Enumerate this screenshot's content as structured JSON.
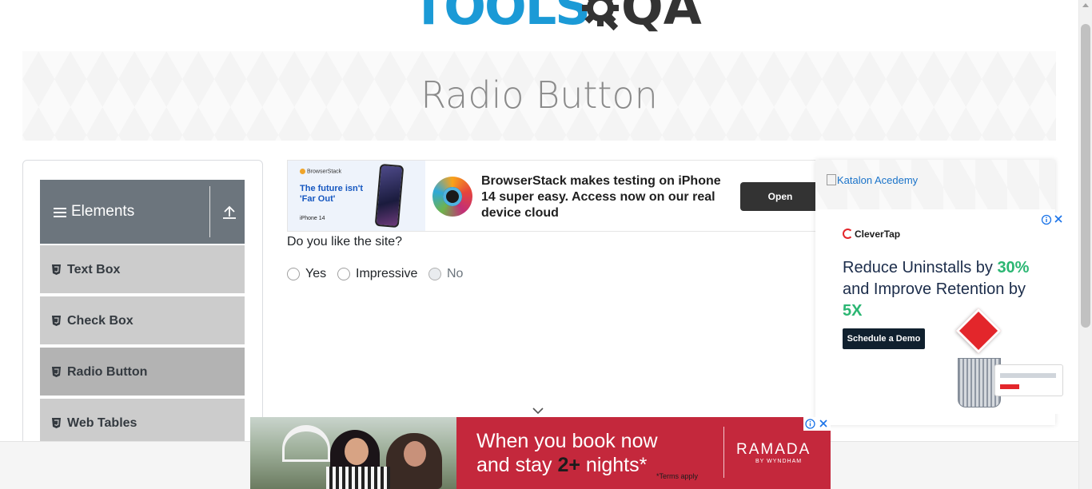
{
  "logo": {
    "text_primary": "TOOLS",
    "text_secondary": "QA"
  },
  "banner": {
    "title": "Radio Button"
  },
  "sidebar": {
    "group": {
      "title": "Elements"
    },
    "items": [
      {
        "label": "Text Box",
        "active": false
      },
      {
        "label": "Check Box",
        "active": false
      },
      {
        "label": "Radio Button",
        "active": true
      },
      {
        "label": "Web Tables",
        "active": false
      }
    ]
  },
  "top_ad": {
    "brand": "BrowserStack",
    "tagline": "The future isn't 'Far Out'",
    "device": "iPhone 14",
    "text": "BrowserStack makes testing on iPhone 14 super easy. Access now on our real device cloud",
    "button": "Open"
  },
  "form": {
    "question": "Do you like the site?",
    "options": [
      {
        "label": "Yes",
        "disabled": false
      },
      {
        "label": "Impressive",
        "disabled": false
      },
      {
        "label": "No",
        "disabled": true
      }
    ]
  },
  "right_card": {
    "image_alt": "Katalon Acedemy",
    "ad": {
      "brand": "CleverTap",
      "headline_1": "Reduce Uninstalls by ",
      "highlight_1": "30%",
      "headline_2": " and Improve Retention by ",
      "highlight_2": "5X",
      "cta": "Schedule a Demo"
    }
  },
  "bottom_ad": {
    "line1": "When you book now",
    "line2_pre": "and stay ",
    "line2_bold": "2+",
    "line2_post": " nights*",
    "terms": "*Terms apply",
    "brand": "RAMADA",
    "brand_sub": "BY WYNDHAM"
  },
  "colors": {
    "brand_blue": "#1b9ad6",
    "group_header": "#6c757d",
    "menu_item": "#cccccc",
    "menu_item_active": "#b3b3b3",
    "ramada_red": "#c4283c",
    "clevertap_green": "#2bb673"
  },
  "icons": [
    "gear-icon",
    "hamburger-icon",
    "collapse-up-icon",
    "html5-icon",
    "chevron-down-icon",
    "info-icon",
    "close-icon",
    "broken-image-icon"
  ]
}
